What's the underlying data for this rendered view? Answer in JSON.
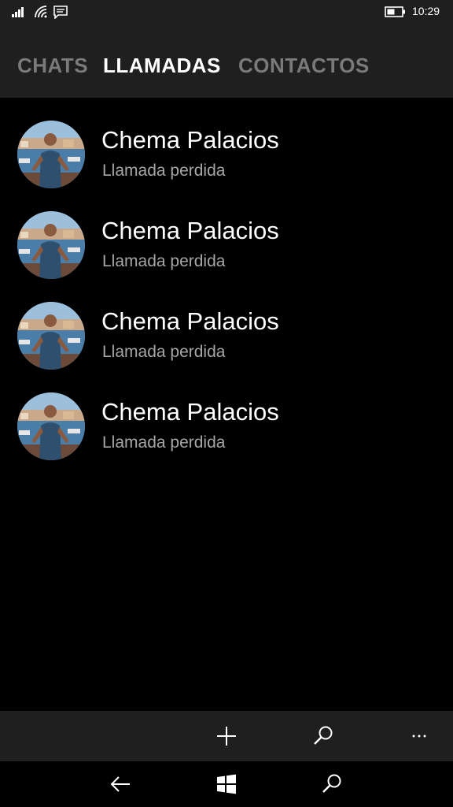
{
  "status_bar": {
    "time": "10:29",
    "icons": [
      "signal-icon",
      "wifi-icon",
      "message-icon",
      "battery-icon"
    ]
  },
  "pivot": {
    "tabs": [
      {
        "label": "CHATS",
        "active": false
      },
      {
        "label": "LLAMADAS",
        "active": true
      },
      {
        "label": "CONTACTOS",
        "active": false
      }
    ]
  },
  "calls": [
    {
      "name": "Chema Palacios",
      "status": "Llamada perdida"
    },
    {
      "name": "Chema Palacios",
      "status": "Llamada perdida"
    },
    {
      "name": "Chema Palacios",
      "status": "Llamada perdida"
    },
    {
      "name": "Chema Palacios",
      "status": "Llamada perdida"
    }
  ],
  "app_bar": {
    "buttons": [
      "add-icon",
      "search-icon",
      "more-icon"
    ]
  },
  "nav_bar": {
    "buttons": [
      "back-arrow-icon",
      "windows-logo-icon",
      "search-icon"
    ]
  },
  "colors": {
    "background": "#000000",
    "chrome": "#1f1f1f",
    "text_primary": "#ffffff",
    "text_secondary": "#a6a6a6",
    "tab_inactive": "#7a7a7a"
  }
}
